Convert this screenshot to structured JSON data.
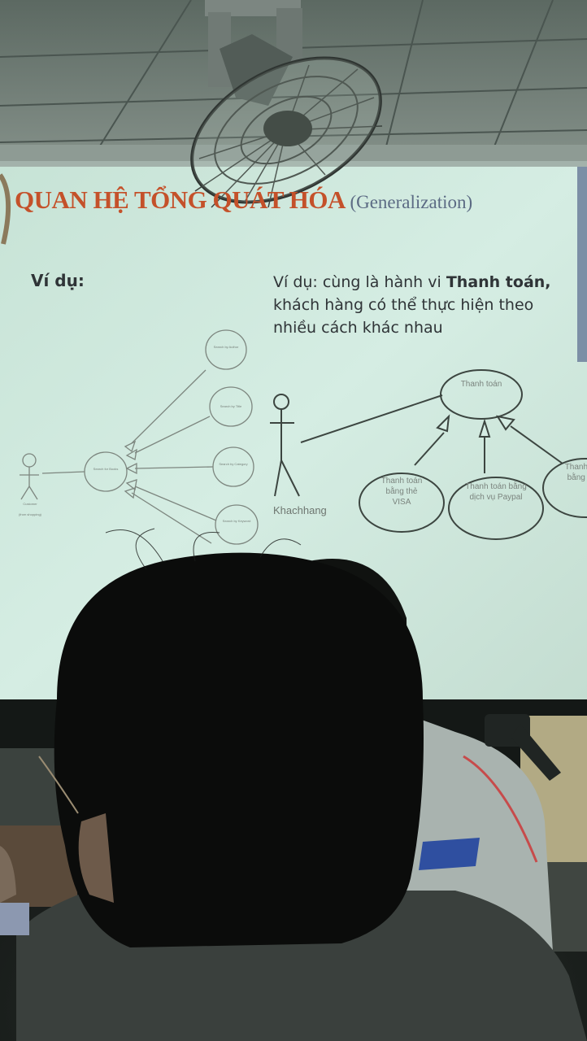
{
  "slide": {
    "title": "QUAN HỆ TỔNG QUÁT HÓA",
    "title_subtitle": "(Generalization)",
    "left_heading": "Ví dụ:",
    "right_text": {
      "prefix": "Ví dụ: cùng là hành vi ",
      "bold": "Thanh toán,",
      "line2": "khách hàng có thể thực hiện theo",
      "line3": "nhiều cách khác nhau"
    }
  },
  "left_diagram": {
    "actor_name": "Customer",
    "actor_note": "(from shopping)",
    "central_usecase": "Search for Books",
    "child_usecases": [
      "Search by Author",
      "Search by Title",
      "Search by Category",
      "Search by Keyword"
    ]
  },
  "right_diagram": {
    "actor_name": "Khachhang",
    "parent_usecase": "Thanh toán",
    "child_usecases": [
      "Thanh toán bằng thẻ VISA",
      "Thanh toán bằng dịch vụ Paypal",
      "Thanh toán bằng ATM"
    ]
  },
  "colors": {
    "slide_bg": "#d3ebe0",
    "title": "#c4512a",
    "subtitle": "#5c6b84",
    "body_text": "#2f3437",
    "hair": "#0b0c0b"
  }
}
